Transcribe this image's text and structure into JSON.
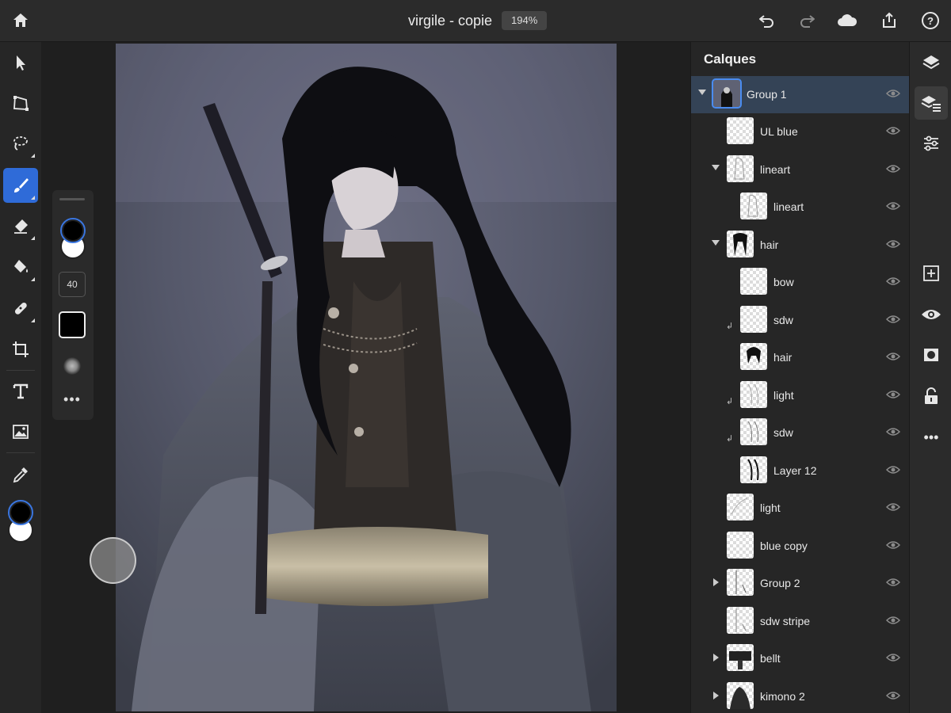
{
  "app": {
    "document_name": "virgile - copie",
    "zoom": "194%"
  },
  "topbar": {
    "icons": [
      "home-icon",
      "undo-icon",
      "redo-icon",
      "cloud-icon",
      "share-icon",
      "help-icon"
    ]
  },
  "left_tools": [
    "select-icon",
    "transform-icon",
    "lasso-icon",
    "brush-icon",
    "eraser-icon",
    "fill-icon",
    "healing-icon",
    "crop-icon",
    "type-icon",
    "place-image-icon",
    "eyedropper-icon"
  ],
  "brush_panel": {
    "size": "40",
    "more": "•••"
  },
  "colors": {
    "foreground": "#000000",
    "background": "#ffffff",
    "accent": "#2f6bd8",
    "selected_row": "#344356"
  },
  "layers_panel": {
    "title": "Calques",
    "layers": [
      {
        "name": "Group 1",
        "expanded": true,
        "selected": true,
        "indent": 0,
        "group": true
      },
      {
        "name": "UL blue",
        "indent": 1
      },
      {
        "name": "lineart",
        "expanded": true,
        "indent": 1,
        "group": true
      },
      {
        "name": "lineart",
        "indent": 2
      },
      {
        "name": "hair",
        "expanded": true,
        "indent": 1,
        "group": true
      },
      {
        "name": "bow",
        "indent": 2
      },
      {
        "name": "sdw",
        "indent": 2,
        "clipped": true
      },
      {
        "name": "hair",
        "indent": 2
      },
      {
        "name": "light",
        "indent": 2,
        "clipped": true
      },
      {
        "name": "sdw",
        "indent": 2,
        "clipped": true
      },
      {
        "name": "Layer 12",
        "indent": 2
      },
      {
        "name": "light",
        "indent": 1
      },
      {
        "name": "blue copy",
        "indent": 1
      },
      {
        "name": "Group 2",
        "indent": 1,
        "group": true,
        "expanded": false
      },
      {
        "name": "sdw stripe",
        "indent": 1
      },
      {
        "name": "bellt",
        "indent": 1,
        "group": true,
        "expanded": false
      },
      {
        "name": "kimono 2",
        "indent": 1,
        "group": true,
        "expanded": false
      }
    ]
  },
  "right_strip": {
    "icons": [
      "layers-icon",
      "layer-properties-icon",
      "adjustments-icon",
      "add-layer-icon",
      "visibility-icon",
      "mask-icon",
      "lock-icon",
      "more-icon"
    ],
    "more": "•••"
  }
}
